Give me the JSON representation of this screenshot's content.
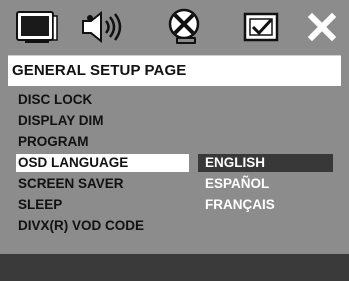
{
  "tabs": [
    {
      "name": "general-setup-tab-icon",
      "icon": "tv-screen-icon"
    },
    {
      "name": "audio-setup-tab-icon",
      "icon": "speaker-icon"
    },
    {
      "name": "video-setup-tab-icon",
      "icon": "video-reel-icon"
    },
    {
      "name": "preference-tab-icon",
      "icon": "preference-check-icon"
    },
    {
      "name": "exit-tab-icon",
      "icon": "close-icon"
    }
  ],
  "page_title": "GENERAL SETUP PAGE",
  "menu_items": [
    {
      "label": "DISC LOCK"
    },
    {
      "label": "DISPLAY DIM"
    },
    {
      "label": "PROGRAM"
    },
    {
      "label": "OSD LANGUAGE",
      "selected": true
    },
    {
      "label": "SCREEN SAVER"
    },
    {
      "label": "SLEEP"
    },
    {
      "label": "DIVX(R) VOD CODE"
    }
  ],
  "submenu_items": [
    {
      "label": "ENGLISH",
      "selected": true
    },
    {
      "label": "ESPAÑOL"
    },
    {
      "label": "FRANÇAIS"
    }
  ],
  "colors": {
    "background": "#8c8c8c",
    "title_bar": "#ffffff",
    "menu_highlight": "#ffffff",
    "submenu_highlight": "#383838",
    "submenu_text": "#ffffff",
    "menu_text": "#111111"
  }
}
